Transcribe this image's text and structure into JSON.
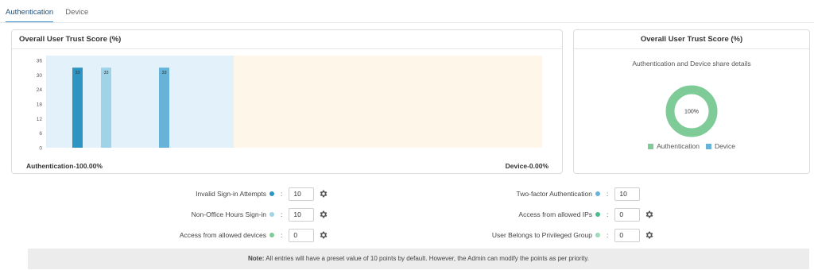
{
  "tabs": [
    {
      "label": "Authentication",
      "active": true
    },
    {
      "label": "Device",
      "active": false
    }
  ],
  "left_card": {
    "title": "Overall User Trust Score (%)",
    "footer_left": "Authentication-100.00%",
    "footer_right": "Device-0.00%"
  },
  "right_card": {
    "title": "Overall User Trust Score (%)",
    "subtitle": "Authentication and Device share details",
    "donut_label": "100%",
    "legend": [
      {
        "label": "Authentication",
        "color": "#7ecb98"
      },
      {
        "label": "Device",
        "color": "#67b2d8"
      }
    ]
  },
  "chart_data": {
    "type": "bar",
    "title": "Overall User Trust Score (%)",
    "ylim": [
      0,
      36
    ],
    "yticks": [
      0,
      6,
      12,
      18,
      24,
      30,
      36
    ],
    "regions": [
      {
        "name": "Authentication",
        "color": "#e3f1fb"
      },
      {
        "name": "Device",
        "color": "#fdf6e9"
      }
    ],
    "series": [
      {
        "values": [
          33,
          33,
          33
        ],
        "colors": [
          "#2e95c2",
          "#9fd3e8",
          "#67b2d8"
        ],
        "labels": [
          "33",
          "33",
          "33"
        ]
      }
    ]
  },
  "settings_left": [
    {
      "label": "Invalid Sign-in Attempts",
      "dot_color": "#2e95c2",
      "value": "10",
      "gear": true
    },
    {
      "label": "Non-Office Hours Sign-in",
      "dot_color": "#9fd3e8",
      "value": "10",
      "gear": true
    },
    {
      "label": "Access from allowed devices",
      "dot_color": "#7ecb98",
      "value": "0",
      "gear": true
    }
  ],
  "settings_right": [
    {
      "label": "Two-factor Authentication",
      "dot_color": "#67b2d8",
      "value": "10",
      "gear": false
    },
    {
      "label": "Access from allowed IPs",
      "dot_color": "#4bbd8a",
      "value": "0",
      "gear": true
    },
    {
      "label": "User Belongs to Privileged Group",
      "dot_color": "#9ed8b6",
      "value": "0",
      "gear": true
    }
  ],
  "separator": ":",
  "note": {
    "prefix": "Note:",
    "text": " All entries will have a preset value of 10 points by default. However, the Admin can modify the points as per priority."
  }
}
